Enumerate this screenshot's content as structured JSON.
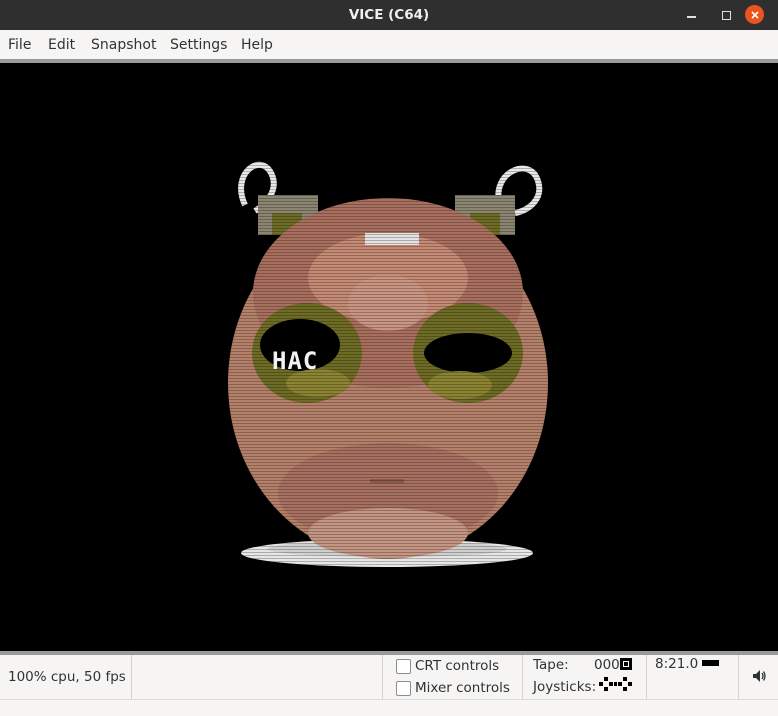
{
  "window": {
    "title": "VICE (C64)"
  },
  "menu": [
    "File",
    "Edit",
    "Snapshot",
    "Settings",
    "Help"
  ],
  "screen": {
    "overlay_text_left": "HAC",
    "overlay_text_right": ""
  },
  "status": {
    "cpu": "100% cpu, 50 fps",
    "crt_controls": "CRT controls",
    "mixer_controls": "Mixer controls",
    "tape_label": "Tape:",
    "tape_counter": "000",
    "joysticks_label": "Joysticks:",
    "time": "8:21.0",
    "volume_icon": "volume-icon"
  },
  "colors": {
    "titlebar": "#2f2f2f",
    "close": "#e95420",
    "skin": "#b5806a",
    "eyes": "#6e6b24"
  }
}
